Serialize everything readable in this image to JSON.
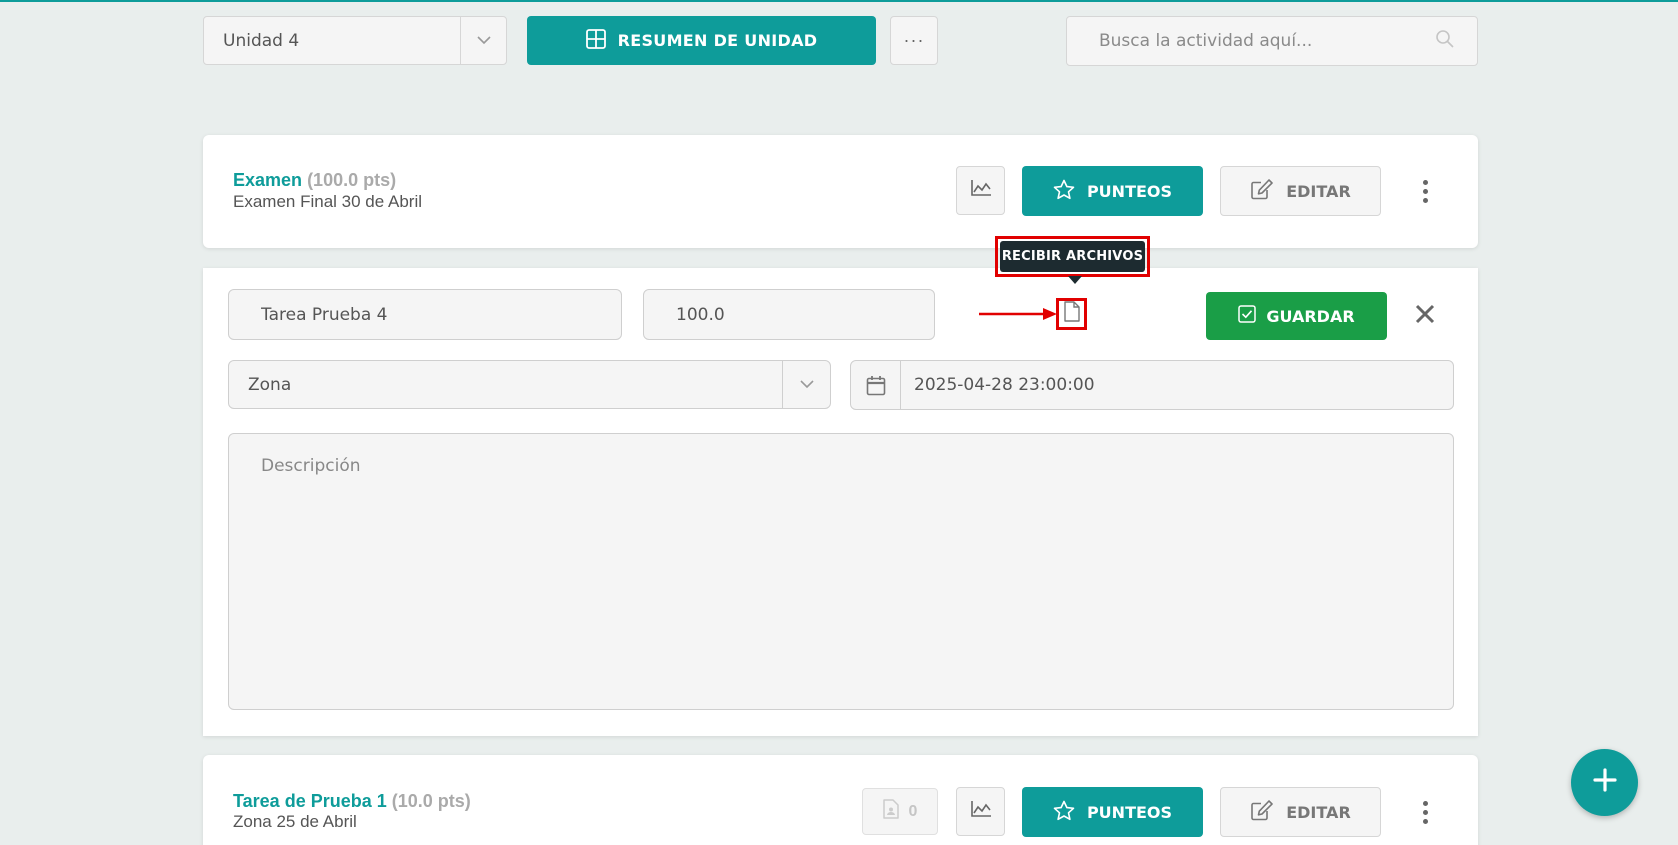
{
  "colors": {
    "accent": "#0e9c9a",
    "save": "#1a9e47",
    "highlight": "#e10000",
    "tooltip_bg": "#1d2b30"
  },
  "toolbar": {
    "unit_value": "Unidad 4",
    "summary_label": "RESUMEN DE UNIDAD",
    "more_label": "···",
    "search_placeholder": "Busca la actividad aquí..."
  },
  "activities": [
    {
      "name": "Examen",
      "points": "(100.0 pts)",
      "subtitle": "Examen Final 30 de Abril",
      "punteos_label": "PUNTEOS",
      "editar_label": "EDITAR"
    },
    {
      "name": "Tarea de Prueba 1",
      "points": "(10.0 pts)",
      "subtitle": "Zona 25 de Abril",
      "files_count": "0",
      "punteos_label": "PUNTEOS",
      "editar_label": "EDITAR"
    }
  ],
  "edit_form": {
    "name_value": "Tarea Prueba 4",
    "points_value": "100.0",
    "tooltip": "RECIBIR ARCHIVOS",
    "save_label": "GUARDAR",
    "category_value": "Zona",
    "date_value": "2025-04-28 23:00:00",
    "description_placeholder": "Descripción"
  },
  "icons": {
    "unit_caret": "chevron-down-icon",
    "summary": "grid-icon",
    "search": "search-icon",
    "stats": "chart-icon",
    "star": "star-icon",
    "edit": "edit-icon",
    "kebab": "vertical-dots-icon",
    "file": "file-icon",
    "check": "checkbox-icon",
    "close": "close-icon",
    "calendar": "calendar-icon",
    "add": "plus-icon"
  }
}
